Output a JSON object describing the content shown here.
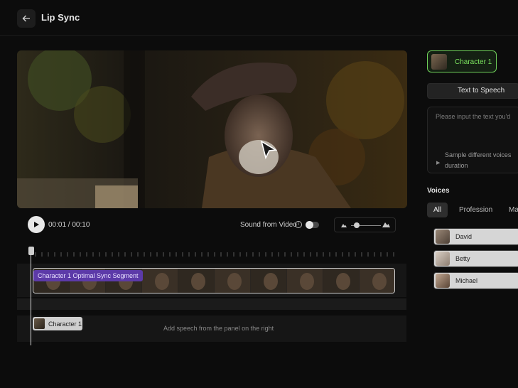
{
  "header": {
    "title": "Lip Sync",
    "back_icon": "arrow-left-icon"
  },
  "player": {
    "time": "00:01 / 00:10",
    "sound_label": "Sound from Video",
    "sound_enabled": false,
    "zoom_level": 0.1
  },
  "timeline": {
    "segment_label": "Character 1 Optimal Sync Segment",
    "character_chip": "Character 1",
    "add_speech_hint": "Add speech from the panel on the right"
  },
  "sidebar": {
    "character_tab": "Character 1",
    "tts_tab": "Text to Speech",
    "text_placeholder": "Please input the text you'd",
    "sample_hint_line1": "Sample different voices",
    "sample_hint_line2": "duration",
    "voices_title": "Voices",
    "filters": [
      "All",
      "Profession",
      "Ma"
    ],
    "voices": [
      "David",
      "Betty",
      "Michael"
    ]
  },
  "colors": {
    "accent_green": "#6fd15a",
    "segment_purple": "#5c3aa8"
  }
}
